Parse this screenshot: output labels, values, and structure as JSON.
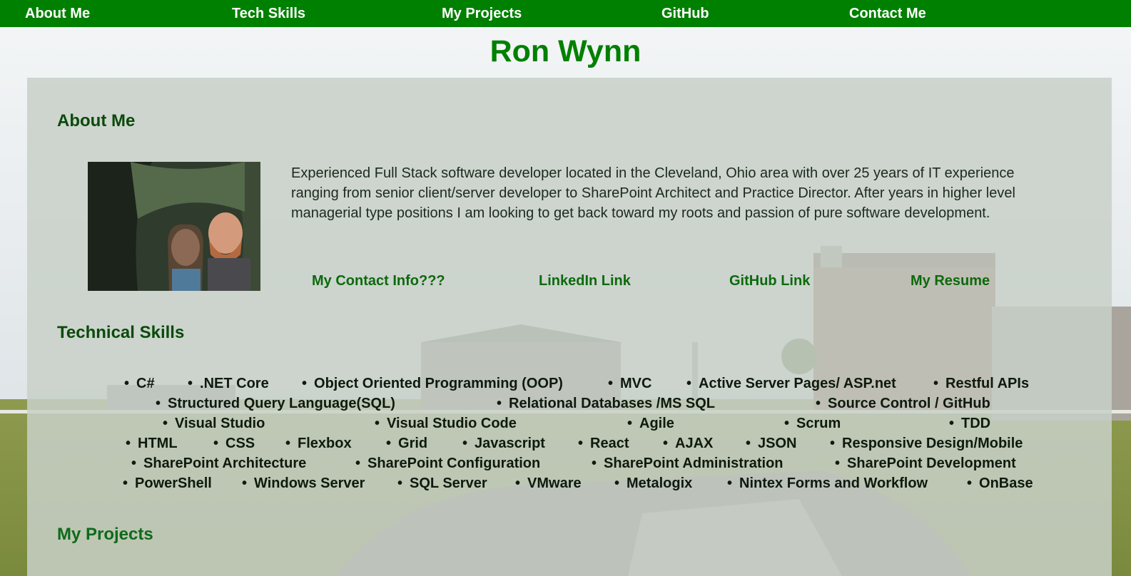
{
  "nav": {
    "items": [
      "About Me",
      "Tech Skills",
      "My Projects",
      "GitHub",
      "Contact Me"
    ]
  },
  "header": {
    "title": "Ron Wynn"
  },
  "about": {
    "heading": "About Me",
    "bio": "Experienced Full Stack software developer located in the Cleveland, Ohio area with over 25 years of IT experience ranging from senior client/server developer to SharePoint Architect and Practice Director. After years in higher level managerial type positions I am looking to get back toward my roots and passion of pure software development.",
    "links": [
      "My Contact Info???",
      "LinkedIn Link",
      "GitHub Link",
      "My Resume"
    ]
  },
  "skills": {
    "heading": "Technical Skills",
    "rows": [
      [
        "C#",
        ".NET Core",
        "Object Oriented Programming (OOP)",
        "MVC",
        "Active Server Pages/ ASP.net",
        "Restful APIs"
      ],
      [
        "Structured Query Language(SQL)",
        "Relational Databases /MS SQL",
        "Source Control / GitHub"
      ],
      [
        "Visual Studio",
        "Visual Studio Code",
        "Agile",
        "Scrum",
        "TDD"
      ],
      [
        "HTML",
        "CSS",
        "Flexbox",
        "Grid",
        "Javascript",
        "React",
        "AJAX",
        "JSON",
        "Responsive Design/Mobile"
      ],
      [
        "SharePoint Architecture",
        "SharePoint Configuration",
        "SharePoint Administration",
        "SharePoint Development"
      ],
      [
        "PowerShell",
        "Windows Server",
        "SQL Server",
        "VMware",
        "Metalogix",
        "Nintex Forms and Workflow",
        "OnBase"
      ]
    ]
  },
  "projects": {
    "heading": "My Projects"
  },
  "colors": {
    "nav_bg": "#008000",
    "title": "#008000",
    "heading": "#0b4a0b",
    "link": "#0c6a0c"
  }
}
